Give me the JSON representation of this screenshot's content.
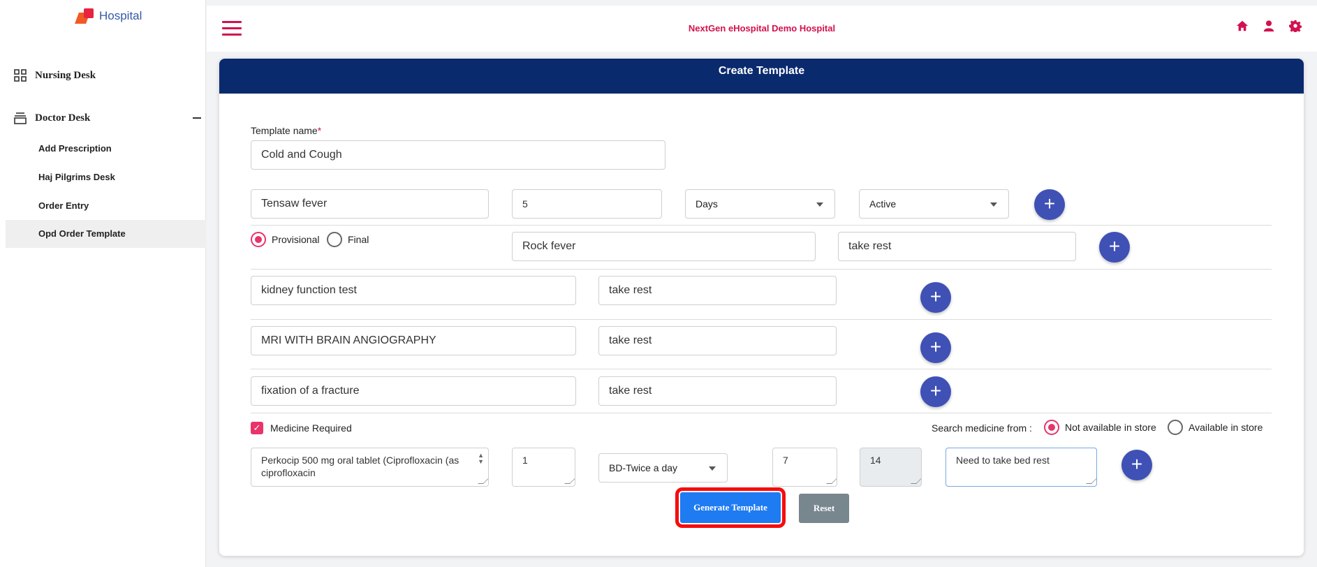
{
  "logo": {
    "text": "Hospital"
  },
  "sidebar": {
    "groups": [
      {
        "label": "Nursing Desk",
        "icon": "grid-icon"
      },
      {
        "label": "Doctor Desk",
        "icon": "stack-icon"
      }
    ],
    "items": [
      {
        "label": "Add Prescription"
      },
      {
        "label": "Haj Pilgrims Desk"
      },
      {
        "label": "Order Entry"
      },
      {
        "label": "Opd Order Template",
        "active": true
      }
    ]
  },
  "header": {
    "title": "NextGen eHospital Demo Hospital",
    "icons": [
      "home-icon",
      "user-icon",
      "gear-icon"
    ],
    "accent": "#d2114e"
  },
  "card": {
    "title": "Create Template",
    "header_color": "#0a2a6e"
  },
  "form": {
    "template_name_label": "Template name",
    "required_mark": "*",
    "template_name": "Cold and Cough",
    "diagnosis_row": {
      "name": "Tensaw fever",
      "duration": "5",
      "unit": "Days",
      "status": "Active"
    },
    "diagnosis_type": {
      "provisional": "Provisional",
      "final": "Final",
      "selected": "Provisional"
    },
    "row2": {
      "name": "Rock fever",
      "advice": "take rest"
    },
    "investigations": [
      {
        "name": "kidney function test",
        "advice": "take rest"
      },
      {
        "name": "MRI WITH BRAIN ANGIOGRAPHY",
        "advice": "take rest"
      },
      {
        "name": "fixation of a fracture",
        "advice": "take rest"
      }
    ],
    "medicine_required": "Medicine Required",
    "search_from_label": "Search medicine from :",
    "search_options": [
      "Not available in store",
      "Available in store"
    ],
    "search_selected": "Not available in store",
    "medicine": {
      "name": "Perkocip 500 mg oral tablet (Ciprofloxacin (as ciprofloxacin",
      "qty": "1",
      "frequency": "BD-Twice a day",
      "days": "7",
      "total": "14",
      "note": "Need to take bed rest"
    },
    "generate_label": "Generate Template",
    "reset_label": "Reset"
  }
}
